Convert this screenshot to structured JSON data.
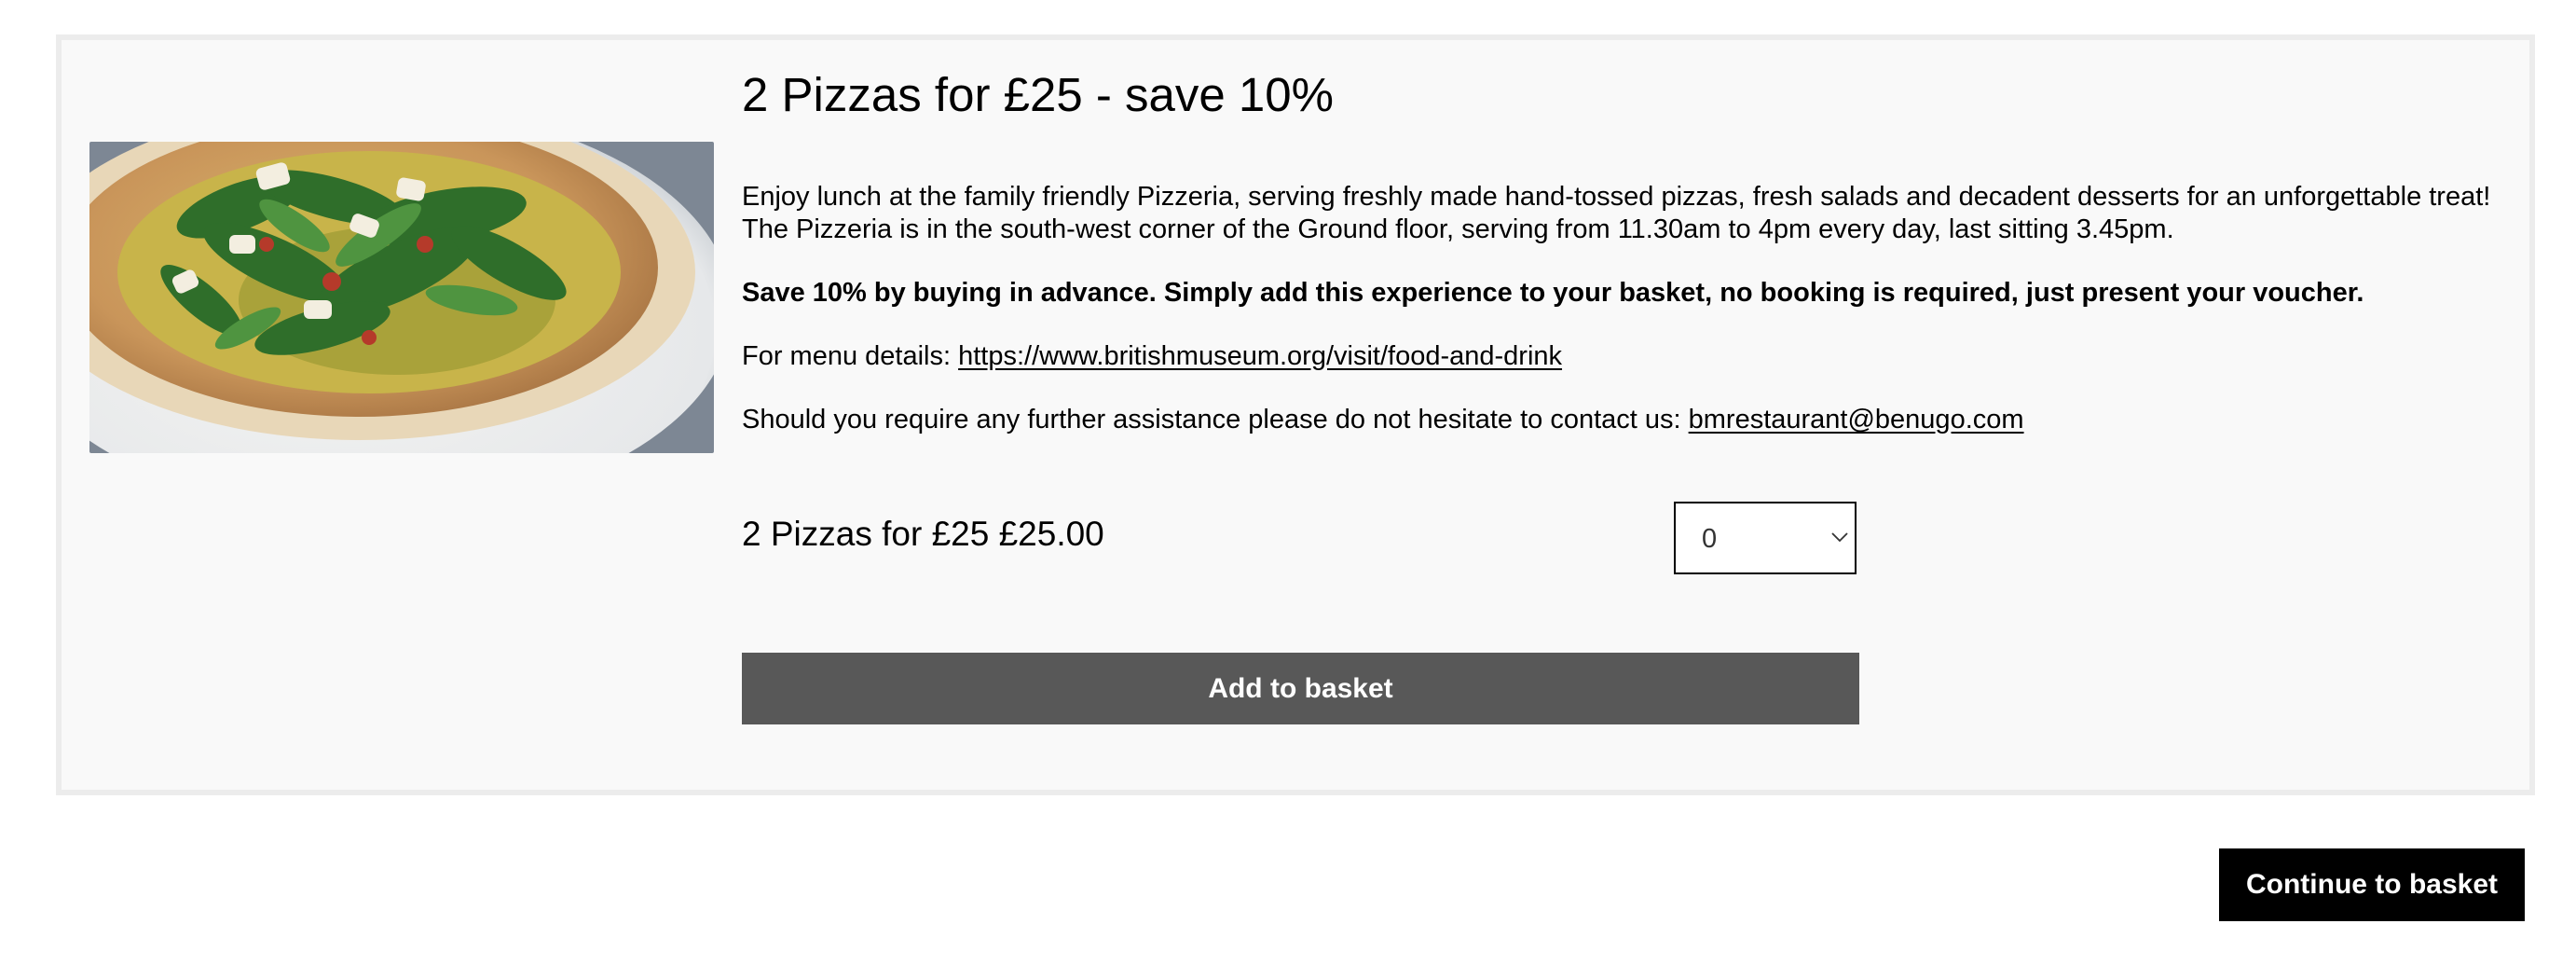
{
  "product": {
    "title": "2 Pizzas for £25 - save 10%",
    "image_alt": "pizza-photo",
    "description": {
      "line1": "Enjoy lunch at the family friendly Pizzeria, serving freshly made hand-tossed pizzas, fresh salads and decadent desserts for an unforgettable treat!",
      "line2": "The Pizzeria is in the south-west corner of the Ground floor, serving from 11.30am to 4pm every day, last sitting 3.45pm.",
      "bold_note": "Save 10% by buying in advance. Simply add this experience to your basket, no booking is required, just present your voucher.",
      "menu_prefix": "For menu details: ",
      "menu_link": "https://www.britishmuseum.org/visit/food-and-drink",
      "contact_prefix": "Should you require any further assistance please do not hesitate to contact us: ",
      "contact_email": "bmrestaurant@benugo.com"
    }
  },
  "ticket": {
    "label": "2 Pizzas for £25 £25.00",
    "quantity": "0"
  },
  "actions": {
    "add_to_basket": "Add to basket",
    "continue": "Continue to basket"
  },
  "colors": {
    "card_bg": "#f9f9f9",
    "add_button_bg": "#585858",
    "continue_button_bg": "#000000"
  }
}
